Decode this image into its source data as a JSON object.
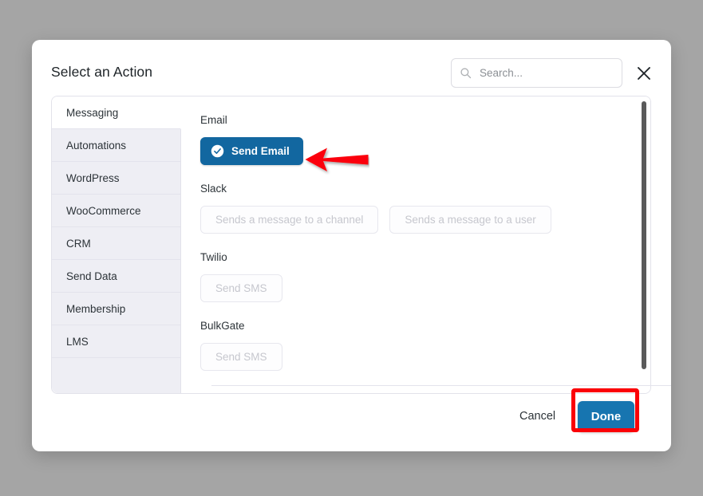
{
  "colors": {
    "overlay": "#a5a5a5",
    "accent_blue": "#1267a0",
    "done_blue": "#1775b0",
    "annotation_red": "#fb0007",
    "sidebar_bg": "#eeeef4"
  },
  "modal": {
    "title": "Select an Action",
    "close_label": "Close",
    "search": {
      "value": "",
      "placeholder": "Search...",
      "icon": "search-icon"
    }
  },
  "sidebar": {
    "items": [
      {
        "label": "Messaging",
        "active": true
      },
      {
        "label": "Automations",
        "active": false
      },
      {
        "label": "WordPress",
        "active": false
      },
      {
        "label": "WooCommerce",
        "active": false
      },
      {
        "label": "CRM",
        "active": false
      },
      {
        "label": "Send Data",
        "active": false
      },
      {
        "label": "Membership",
        "active": false
      },
      {
        "label": "LMS",
        "active": false
      }
    ]
  },
  "content": {
    "groups": [
      {
        "label": "Email",
        "actions": [
          {
            "label": "Send Email",
            "state": "selected",
            "icon": "check-circle-icon"
          }
        ]
      },
      {
        "label": "Slack",
        "actions": [
          {
            "label": "Sends a message to a channel",
            "state": "disabled"
          },
          {
            "label": "Sends a message to a user",
            "state": "disabled"
          }
        ]
      },
      {
        "label": "Twilio",
        "actions": [
          {
            "label": "Send SMS",
            "state": "disabled"
          }
        ]
      },
      {
        "label": "BulkGate",
        "actions": [
          {
            "label": "Send SMS",
            "state": "disabled"
          }
        ]
      }
    ]
  },
  "footer": {
    "cancel_label": "Cancel",
    "done_label": "Done"
  },
  "annotations": {
    "arrow": {
      "points_to": "Send Email",
      "direction": "left",
      "color": "#fb0007"
    },
    "box": {
      "around": "Done",
      "color": "#fb0007"
    }
  }
}
